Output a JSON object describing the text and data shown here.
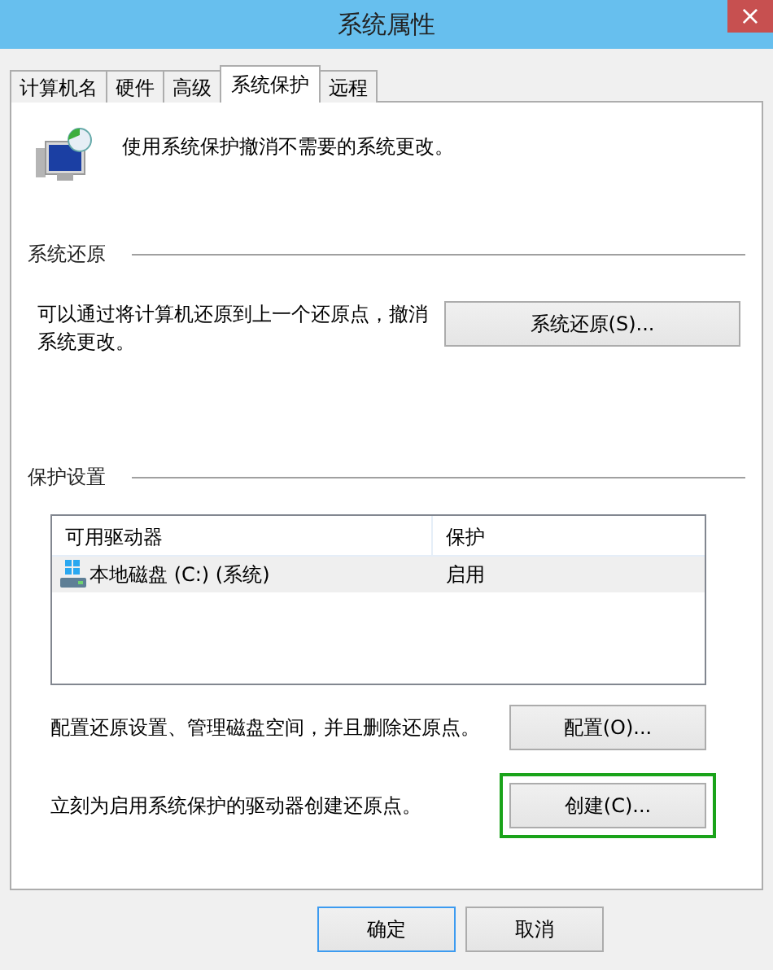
{
  "window": {
    "title": "系统属性",
    "close": "×"
  },
  "tabs": [
    {
      "label": "计算机名",
      "selected": false
    },
    {
      "label": "硬件",
      "selected": false
    },
    {
      "label": "高级",
      "selected": false
    },
    {
      "label": "系统保护",
      "selected": true
    },
    {
      "label": "远程",
      "selected": false
    }
  ],
  "intro": "使用系统保护撤消不需要的系统更改。",
  "restore_section": {
    "title": "系统还原",
    "description": "可以通过将计算机还原到上一个还原点，撤消系统更改。",
    "button": "系统还原(S)..."
  },
  "protection_section": {
    "title": "保护设置",
    "table": {
      "columns": [
        "可用驱动器",
        "保护"
      ],
      "rows": [
        {
          "drive": "本地磁盘 (C:) (系统)",
          "protection": "启用",
          "selected": true
        }
      ]
    },
    "configure": {
      "description": "配置还原设置、管理磁盘空间，并且删除还原点。",
      "button": "配置(O)..."
    },
    "create": {
      "description": "立刻为启用系统保护的驱动器创建还原点。",
      "button": "创建(C)...",
      "highlighted": true
    }
  },
  "buttons": [
    {
      "label": "确定",
      "default": true
    },
    {
      "label": "取消",
      "default": false
    }
  ]
}
